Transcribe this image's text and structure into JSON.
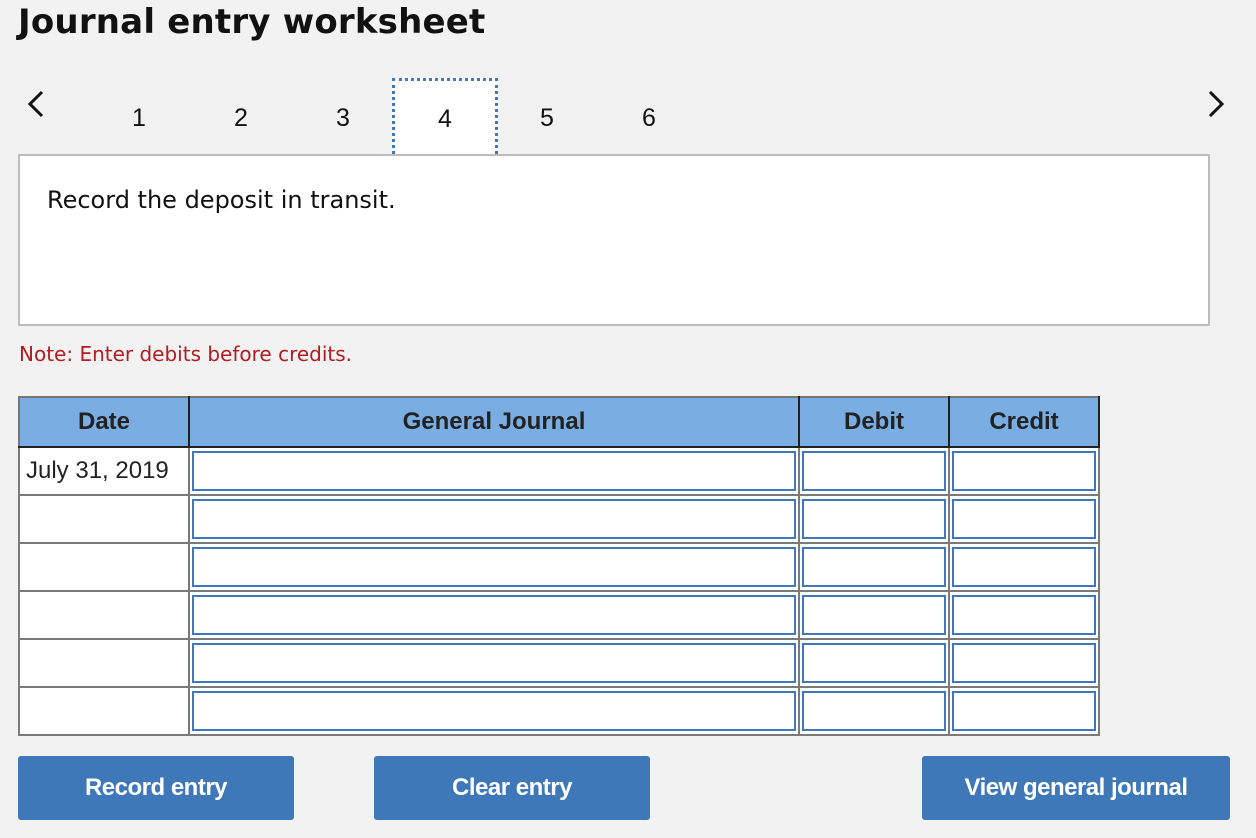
{
  "header": {
    "title": "Journal entry worksheet"
  },
  "pager": {
    "prev_icon": "chevron-left-icon",
    "next_icon": "chevron-right-icon",
    "tabs": [
      "1",
      "2",
      "3",
      "4",
      "5",
      "6"
    ],
    "active_tab": "4"
  },
  "prompt": {
    "text": "Record the deposit in transit."
  },
  "note": {
    "text": "Note: Enter debits before credits."
  },
  "journal": {
    "headers": {
      "date": "Date",
      "general_journal": "General Journal",
      "debit": "Debit",
      "credit": "Credit"
    },
    "rows": [
      {
        "date": "July 31, 2019",
        "account": "",
        "debit": "",
        "credit": ""
      },
      {
        "date": "",
        "account": "",
        "debit": "",
        "credit": ""
      },
      {
        "date": "",
        "account": "",
        "debit": "",
        "credit": ""
      },
      {
        "date": "",
        "account": "",
        "debit": "",
        "credit": ""
      },
      {
        "date": "",
        "account": "",
        "debit": "",
        "credit": ""
      },
      {
        "date": "",
        "account": "",
        "debit": "",
        "credit": ""
      }
    ]
  },
  "buttons": {
    "record": "Record entry",
    "clear": "Clear entry",
    "view": "View general journal"
  },
  "colors": {
    "accent": "#3f78b8",
    "header_bg": "#7aade2",
    "note": "#b01c22"
  }
}
